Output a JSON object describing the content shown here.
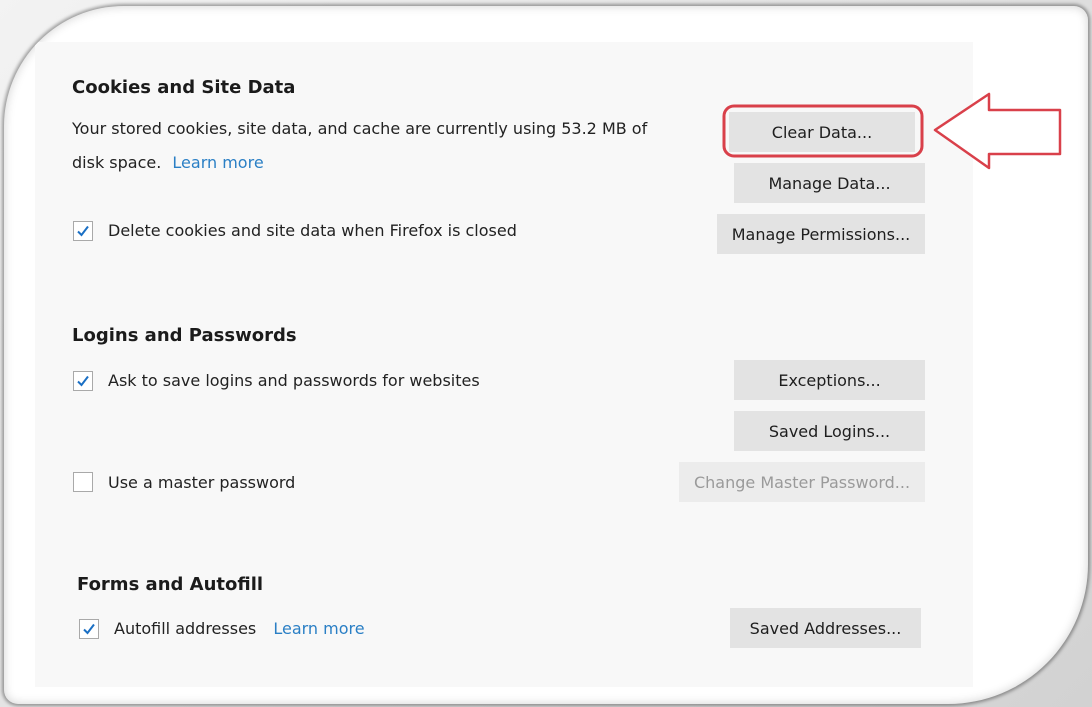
{
  "cookies": {
    "heading": "Cookies and Site Data",
    "description_line1": "Your stored cookies, site data, and cache are currently using 53.2 MB of",
    "description_line2": "disk space.",
    "learn_more": "Learn more",
    "delete_on_close_label": "Delete cookies and site data when Firefox is closed",
    "delete_on_close_checked": true,
    "clear_data_button": "Clear Data...",
    "manage_data_button": "Manage Data...",
    "manage_permissions_button": "Manage Permissions..."
  },
  "logins": {
    "heading": "Logins and Passwords",
    "ask_to_save_label": "Ask to save logins and passwords for websites",
    "ask_to_save_checked": true,
    "exceptions_button": "Exceptions...",
    "saved_logins_button": "Saved Logins...",
    "master_password_label": "Use a master password",
    "master_password_checked": false,
    "change_master_password_button": "Change Master Password..."
  },
  "forms": {
    "heading": "Forms and Autofill",
    "autofill_label": "Autofill addresses",
    "autofill_checked": true,
    "learn_more": "Learn more",
    "saved_addresses_button": "Saved Addresses..."
  },
  "colors": {
    "link": "#2a7fc5",
    "annotation": "#d9404a",
    "checkmark": "#1a6fc4"
  }
}
